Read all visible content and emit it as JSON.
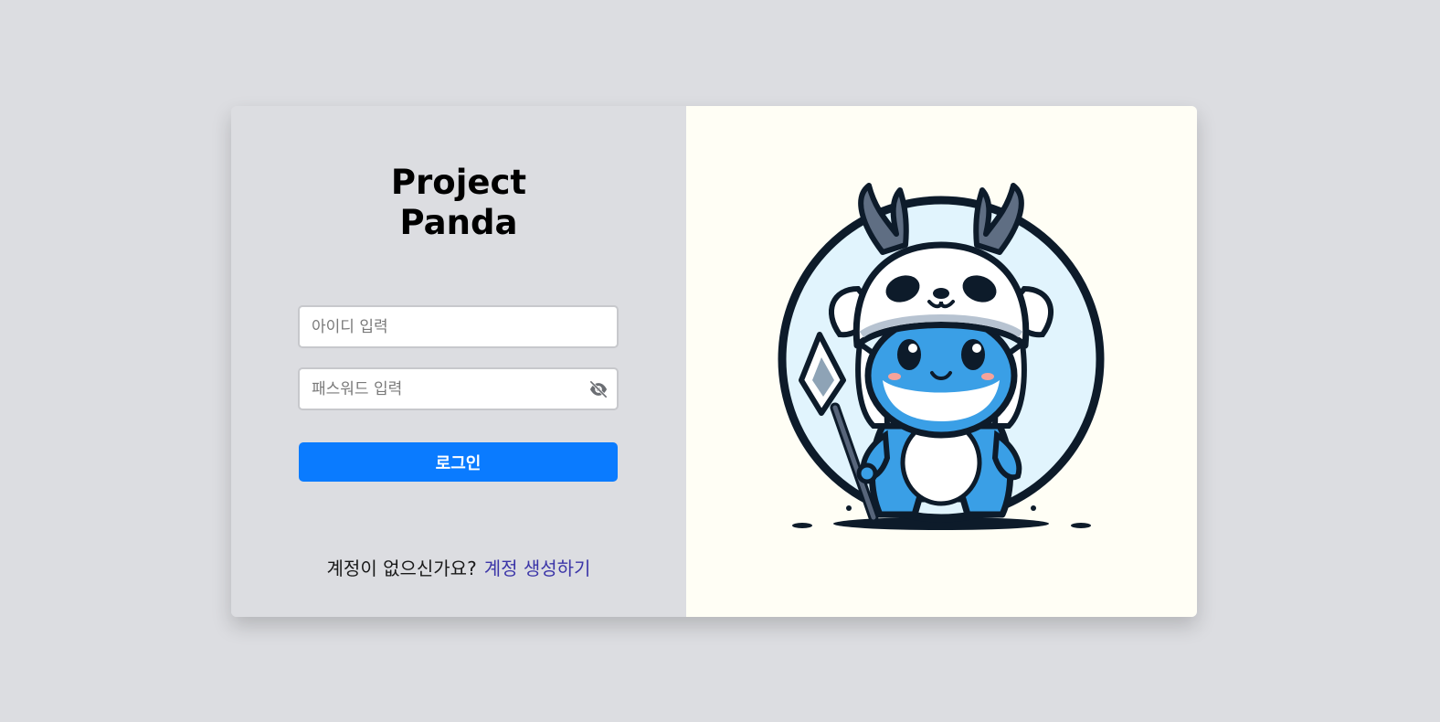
{
  "app": {
    "title_line1": "Project",
    "title_line2": "Panda"
  },
  "login_form": {
    "id_placeholder": "아이디 입력",
    "password_placeholder": "패스워드 입력",
    "login_label": "로그인",
    "password_toggle_icon": "eye-slash-icon"
  },
  "signup": {
    "prompt": "계정이 없으신가요?",
    "link_label": "계정 생성하기"
  },
  "colors": {
    "page_background": "#dcdde1",
    "image_panel_background": "#fffef5",
    "primary_button": "#0a7bff",
    "link": "#3b35a8"
  },
  "illustration": {
    "name": "panda-deer-mascot"
  }
}
